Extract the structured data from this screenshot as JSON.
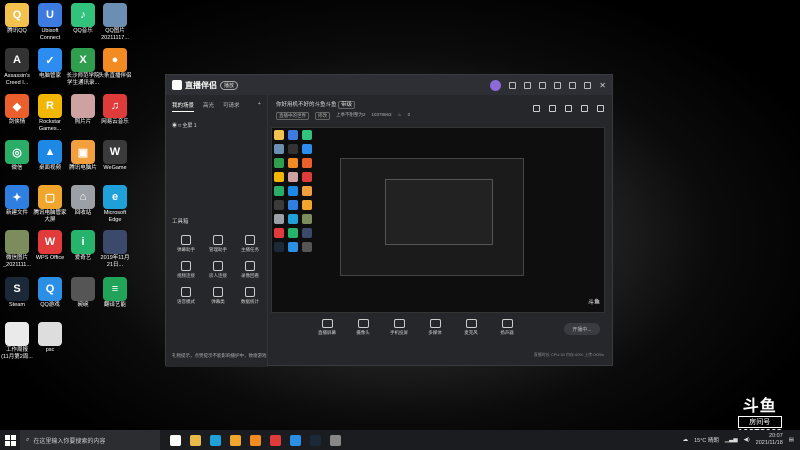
{
  "desktop_icons": [
    {
      "label": "腾讯QQ",
      "color": "#f2c14e",
      "glyph": "Q"
    },
    {
      "label": "Ubisoft\nConnect",
      "color": "#3d7be0",
      "glyph": "U"
    },
    {
      "label": "QQ音乐",
      "color": "#31c27c",
      "glyph": "♪"
    },
    {
      "label": "QQ图片\n20211117...",
      "color": "#6a8fb3",
      "glyph": ""
    },
    {
      "label": "Assassin's\nCreed I...",
      "color": "#333333",
      "glyph": "A"
    },
    {
      "label": "电脑管家",
      "color": "#2d8cf0",
      "glyph": "✓"
    },
    {
      "label": "长沙师范学院\n学生通讯录...",
      "color": "#2f9e4f",
      "glyph": "X"
    },
    {
      "label": "头条直播伴侣",
      "color": "#f28b22",
      "glyph": "●"
    },
    {
      "label": "剑侠情",
      "color": "#ea5f2b",
      "glyph": "◆"
    },
    {
      "label": "Rockstar\nGames...",
      "color": "#f2b705",
      "glyph": "R"
    },
    {
      "label": "照片片",
      "color": "#cfa2a2",
      "glyph": ""
    },
    {
      "label": "网易云音乐",
      "color": "#e03b3b",
      "glyph": "♫"
    },
    {
      "label": "微信",
      "color": "#2aae67",
      "glyph": "◎"
    },
    {
      "label": "桌面视频",
      "color": "#1e88e5",
      "glyph": "▲"
    },
    {
      "label": "腾讯电脑片",
      "color": "#f2a03d",
      "glyph": "▣"
    },
    {
      "label": "WeGame",
      "color": "#3a3a3a",
      "glyph": "W"
    },
    {
      "label": "新建文件",
      "color": "#2f7fe0",
      "glyph": "✦"
    },
    {
      "label": "腾讯电脑管家\n大屏",
      "color": "#f0a52c",
      "glyph": "▢"
    },
    {
      "label": "回收站",
      "color": "#9aa0a6",
      "glyph": "⌂"
    },
    {
      "label": "Microsoft\nEdge",
      "color": "#1fa0d8",
      "glyph": "e"
    },
    {
      "label": "微信图片\n_2021111...",
      "color": "#7d8c5c",
      "glyph": ""
    },
    {
      "label": "WPS Office",
      "color": "#e23b3b",
      "glyph": "W"
    },
    {
      "label": "爱奇艺",
      "color": "#26b36b",
      "glyph": "i"
    },
    {
      "label": "2019年11月\n21日...",
      "color": "#3b4a6b",
      "glyph": ""
    },
    {
      "label": "Steam",
      "color": "#1b2838",
      "glyph": "S"
    },
    {
      "label": "QQ游戏",
      "color": "#2b8fe6",
      "glyph": "Q"
    },
    {
      "label": "碗碗",
      "color": "#555555",
      "glyph": ""
    },
    {
      "label": "翻译艺能",
      "color": "#22a35a",
      "glyph": "≡"
    },
    {
      "label": "工作周报\n(11月第2周...",
      "color": "#eaeaea",
      "glyph": ""
    },
    {
      "label": "psc",
      "color": "#dddddd",
      "glyph": ""
    }
  ],
  "app": {
    "logo": "直播伴侣",
    "logo_pill": "播放",
    "tabs": [
      "我的场景",
      "高光",
      "可请求"
    ],
    "scene_name": "全屏 1",
    "tools_title": "工具箱",
    "tools": [
      "弹幕助手",
      "管理助手",
      "主播任务",
      "视频连接",
      "房人连接",
      "录像回看",
      "语音模式",
      "弹幕类",
      "数据统计"
    ],
    "room_title": "你好用机不好的斗鱼斗鱼",
    "room_badge": "带级",
    "room_chip1": "直播中的世界",
    "room_chip2": "修改",
    "room_sub": "上季不耐整为2",
    "room_id": "10378663",
    "viewers": "0",
    "bottom_tools": [
      "直播屏幕",
      "摄像头",
      "手机投屏",
      "多媒体",
      "麦克风",
      "扬声器"
    ],
    "start_live": "开播中...",
    "status": "直播时长 CPU:30 内存:60% 上传:0KB/s",
    "notice": "礼物提示，点赞提示不能影响播护中，致谢游戏"
  },
  "watermark": {
    "brand": "斗鱼",
    "room_label": "房间号",
    "room_number": "10378663"
  },
  "taskbar": {
    "search_placeholder": "在这里输入你要搜索的内容",
    "task_colors": [
      "#ffffff",
      "#e9b949",
      "#1fa0d8",
      "#f0a52c",
      "#f28b22",
      "#e03b3b",
      "#2b8fe6",
      "#1b2838",
      "#888888"
    ],
    "weather": "15°C 晴朗",
    "time": "20:07",
    "date": "2021/11/18"
  }
}
